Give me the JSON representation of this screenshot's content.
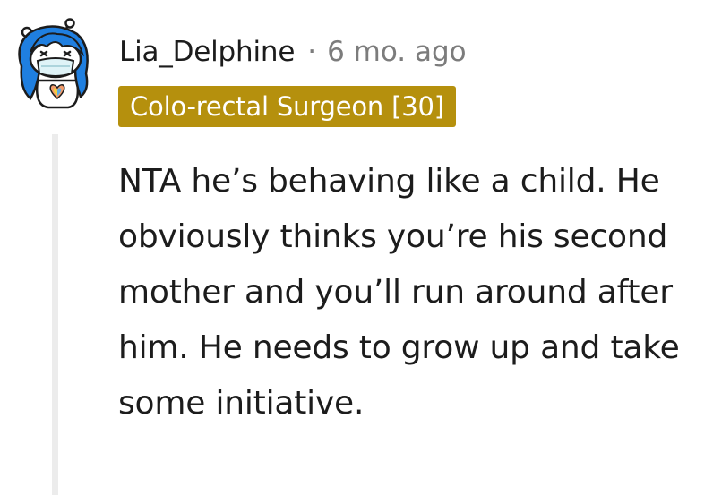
{
  "comment": {
    "author": "Lia_Delphine",
    "separator": "·",
    "timestamp": "6 mo. ago",
    "flair": "Colo-rectal Surgeon [30]",
    "flair_color": "#b5900d",
    "body": "NTA he’s behaving like a child. He obviously thinks you’re his second mother and you’ll run around after him. He needs to grow up and take some initiative."
  },
  "avatar": {
    "icon": "snoo-avatar-blue-hair-mask-icon",
    "hair_color": "#1f7fe0",
    "mask_color": "#dff3f7"
  },
  "thread": {
    "line_color": "#ececec"
  }
}
